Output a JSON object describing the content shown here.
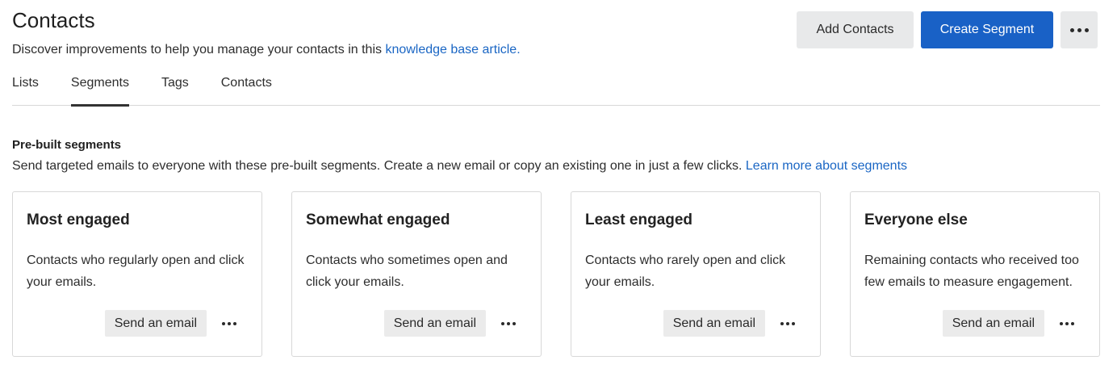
{
  "header": {
    "title": "Contacts",
    "subtitle_text": "Discover improvements to help you manage your contacts in this ",
    "subtitle_link": "knowledge base article."
  },
  "actions": {
    "add_contacts": "Add Contacts",
    "create_segment": "Create Segment",
    "more_icon": "more-horizontal-icon"
  },
  "tabs": [
    {
      "label": "Lists",
      "active": false
    },
    {
      "label": "Segments",
      "active": true
    },
    {
      "label": "Tags",
      "active": false
    },
    {
      "label": "Contacts",
      "active": false
    }
  ],
  "section": {
    "title": "Pre-built segments",
    "desc_text": "Send targeted emails to everyone with these pre-built segments. Create a new email or copy an existing one in just a few clicks. ",
    "desc_link": "Learn more about segments"
  },
  "cards": [
    {
      "title": "Most engaged",
      "desc": "Contacts who regularly open and click your emails.",
      "button": "Send an email"
    },
    {
      "title": "Somewhat engaged",
      "desc": "Contacts who sometimes open and click your emails.",
      "button": "Send an email"
    },
    {
      "title": "Least engaged",
      "desc": "Contacts who rarely open and click your emails.",
      "button": "Send an email"
    },
    {
      "title": "Everyone else",
      "desc": "Remaining contacts who received too few emails to measure engagement.",
      "button": "Send an email"
    }
  ],
  "colors": {
    "primary": "#1961c6",
    "link": "#1a66c4",
    "secondary_bg": "#e8e9ea"
  }
}
